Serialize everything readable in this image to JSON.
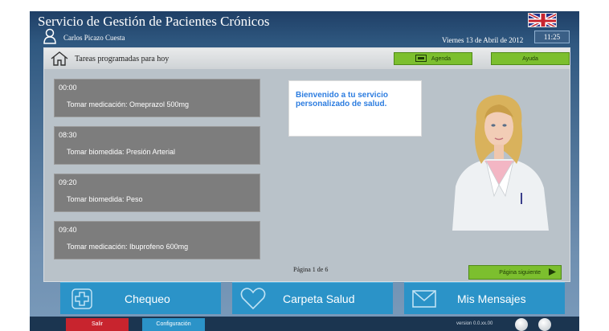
{
  "header": {
    "app_title": "Servicio de Gestión de Pacientes Crónicos",
    "user_name": "Carlos Picazo Cuesta",
    "date": "Viernes 13 de Abril de 2012",
    "time": "11:25",
    "language_flag": "uk-flag-icon"
  },
  "panel": {
    "title": "Tareas programadas para hoy",
    "agenda_label": "Agenda",
    "help_label": "Ayuda",
    "welcome_text": "Bienvenido a tu servicio personalizado de salud.",
    "page_label": "Página 1 de 6",
    "next_label": "Página siguiente",
    "tasks": [
      {
        "time": "00:00",
        "desc": "Tomar medicación: Omeprazol 500mg"
      },
      {
        "time": "08:30",
        "desc": "Tomar biomedida: Presión Arterial"
      },
      {
        "time": "09:20",
        "desc": "Tomar biomedida: Peso"
      },
      {
        "time": "09:40",
        "desc": "Tomar medicación: Ibuprofeno 600mg"
      }
    ]
  },
  "nav": {
    "chequeo": "Chequeo",
    "carpeta": "Carpeta Salud",
    "mensajes": "Mis Mensajes"
  },
  "footer": {
    "salir": "Salir",
    "config": "Configuración",
    "version": "version 0.0.xx.00"
  },
  "colors": {
    "accent_green": "#7cbf2e",
    "nav_blue": "#2b93c8",
    "exit_red": "#c8242e"
  }
}
